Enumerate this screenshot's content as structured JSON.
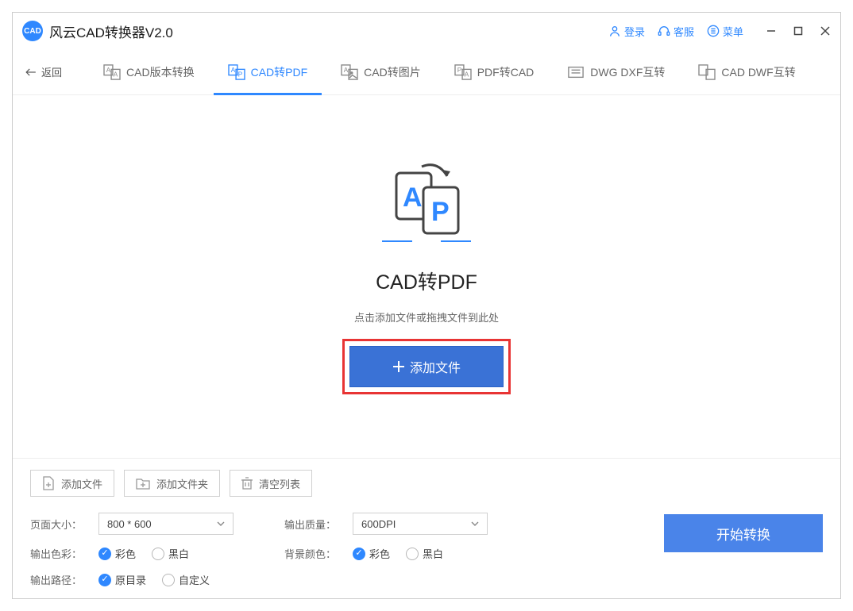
{
  "title": "风云CAD转换器V2.0",
  "titlebar": {
    "login": "登录",
    "service": "客服",
    "menu": "菜单"
  },
  "back_label": "返回",
  "tabs": [
    {
      "label": "CAD版本转换"
    },
    {
      "label": "CAD转PDF"
    },
    {
      "label": "CAD转图片"
    },
    {
      "label": "PDF转CAD"
    },
    {
      "label": "DWG DXF互转"
    },
    {
      "label": "CAD DWF互转"
    }
  ],
  "main": {
    "title": "CAD转PDF",
    "subtitle": "点击添加文件或拖拽文件到此处",
    "add_button": "添加文件"
  },
  "file_actions": {
    "add_file": "添加文件",
    "add_folder": "添加文件夹",
    "clear_list": "清空列表"
  },
  "settings": {
    "page_size_label": "页面大小：",
    "page_size_value": "800 * 600",
    "quality_label": "输出质量：",
    "quality_value": "600DPI",
    "color_label": "输出色彩：",
    "color_options": {
      "color": "彩色",
      "bw": "黑白"
    },
    "bg_label": "背景颜色：",
    "bg_options": {
      "color": "彩色",
      "bw": "黑白"
    },
    "path_label": "输出路径：",
    "path_options": {
      "original": "原目录",
      "custom": "自定义"
    }
  },
  "start_button": "开始转换"
}
